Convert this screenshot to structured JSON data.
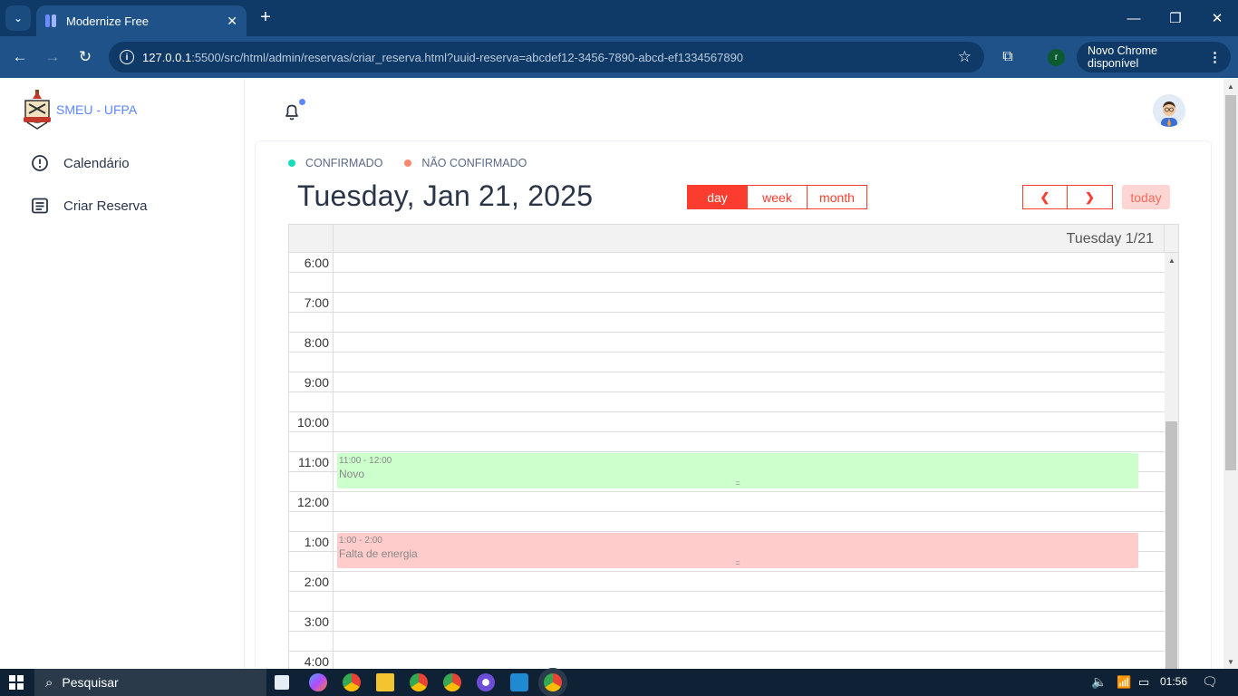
{
  "browser": {
    "tab_title": "Modernize Free",
    "url_host": "127.0.0.1",
    "url_path": ":5500/src/html/admin/reservas/criar_reserva.html?uuid-reserva=abcdef12-3456-7890-abcd-ef1334567890",
    "update_label": "Novo Chrome disponível",
    "profile_initial": "r"
  },
  "sidebar": {
    "brand": "SMEU - UFPA",
    "items": [
      {
        "label": "Calendário",
        "icon": "alert-circle-icon"
      },
      {
        "label": "Criar Reserva",
        "icon": "list-details-icon"
      }
    ]
  },
  "legend": [
    {
      "label": "CONFIRMADO",
      "color": "#13deb9"
    },
    {
      "label": "NÃO CONFIRMADO",
      "color": "#fa896b"
    }
  ],
  "calendar": {
    "title": "Tuesday, Jan 21, 2025",
    "views": [
      "day",
      "week",
      "month"
    ],
    "active_view": "day",
    "prev_label": "❮",
    "next_label": "❯",
    "today_label": "today",
    "day_header": "Tuesday 1/21",
    "hour_labels": [
      "6:00",
      "7:00",
      "8:00",
      "9:00",
      "10:00",
      "11:00",
      "12:00",
      "1:00",
      "2:00",
      "3:00",
      "4:00"
    ],
    "events": [
      {
        "time": "11:00 - 12:00",
        "title": "Novo",
        "color": "#ccffcc",
        "start_hour_index": 5
      },
      {
        "time": "1:00 - 2:00",
        "title": "Falta de energia",
        "color": "#ffcccc",
        "start_hour_index": 7
      }
    ]
  },
  "taskbar": {
    "search_placeholder": "Pesquisar",
    "time": "01:56"
  },
  "colors": {
    "accent_red": "#fa3d2f",
    "brand_blue": "#5d87ff",
    "chrome_dark": "#0f3a67",
    "chrome_mid": "#1e5288"
  }
}
